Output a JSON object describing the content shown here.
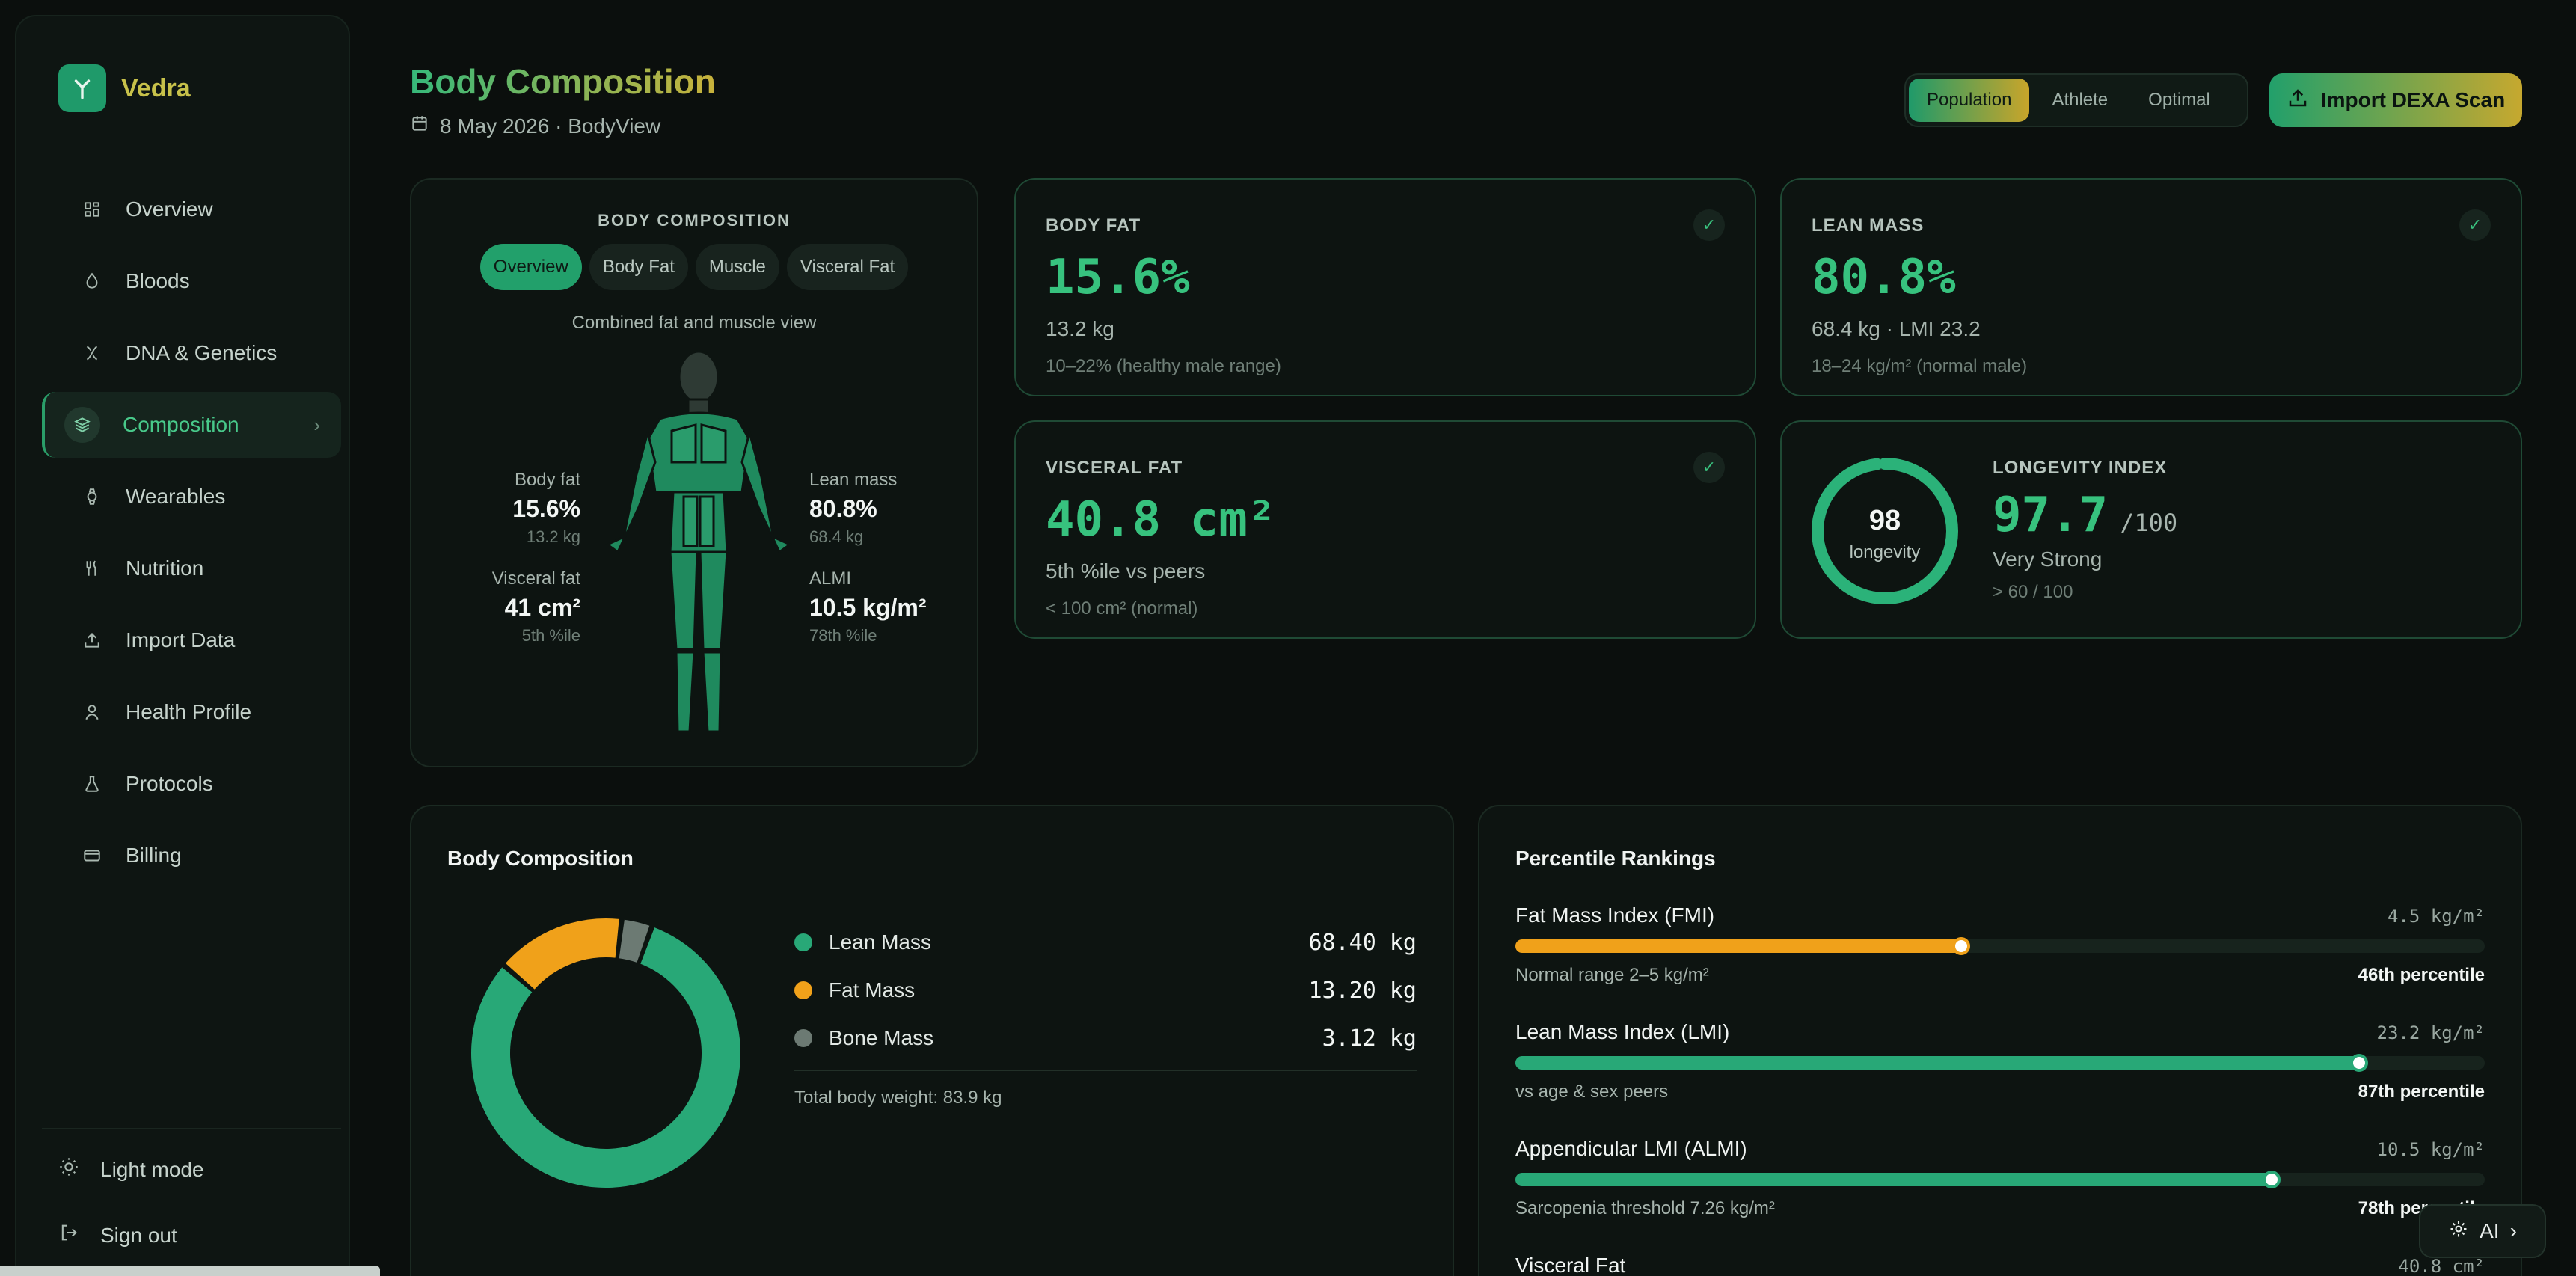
{
  "brand": {
    "name": "Vedra"
  },
  "sidebar": {
    "items": [
      {
        "label": "Overview",
        "icon": "grid-icon"
      },
      {
        "label": "Bloods",
        "icon": "drop-icon"
      },
      {
        "label": "DNA & Genetics",
        "icon": "dna-icon"
      },
      {
        "label": "Composition",
        "icon": "layers-icon",
        "active": true
      },
      {
        "label": "Wearables",
        "icon": "watch-icon"
      },
      {
        "label": "Nutrition",
        "icon": "utensils-icon"
      },
      {
        "label": "Import Data",
        "icon": "upload-icon"
      },
      {
        "label": "Health Profile",
        "icon": "user-icon"
      },
      {
        "label": "Protocols",
        "icon": "flask-icon"
      },
      {
        "label": "Billing",
        "icon": "card-icon"
      }
    ],
    "light_mode": "Light mode",
    "sign_out": "Sign out"
  },
  "header": {
    "title": "Body Composition",
    "subtitle": "8 May 2026 · BodyView",
    "segments": [
      "Population",
      "Athlete",
      "Optimal"
    ],
    "import_label": "Import DEXA Scan"
  },
  "body_map": {
    "title": "BODY COMPOSITION",
    "tabs": [
      "Overview",
      "Body Fat",
      "Muscle",
      "Visceral Fat"
    ],
    "caption": "Combined fat and muscle view",
    "stats": {
      "body_fat": {
        "label": "Body fat",
        "value": "15.6%",
        "sub": "13.2 kg"
      },
      "visceral": {
        "label": "Visceral fat",
        "value": "41 cm²",
        "sub": "5th %ile"
      },
      "lean": {
        "label": "Lean mass",
        "value": "80.8%",
        "sub": "68.4 kg"
      },
      "almi": {
        "label": "ALMI",
        "value": "10.5 kg/m²",
        "sub": "78th %ile"
      }
    }
  },
  "metrics": {
    "body_fat": {
      "label": "BODY FAT",
      "value": "15.6%",
      "sub": "13.2 kg",
      "note": "10–22% (healthy male range)"
    },
    "lean_mass": {
      "label": "LEAN MASS",
      "value": "80.8%",
      "sub": "68.4 kg · LMI 23.2",
      "note": "18–24 kg/m² (normal male)"
    },
    "visceral": {
      "label": "VISCERAL FAT",
      "value": "40.8 cm²",
      "sub": "5th %ile vs peers",
      "note": "< 100 cm² (normal)"
    },
    "longevity": {
      "label": "LONGEVITY INDEX",
      "ring_value": "98",
      "ring_label": "longevity",
      "score": 98,
      "value": "97.7",
      "unit": "/100",
      "sub": "Very Strong",
      "note": "> 60 / 100"
    }
  },
  "composition": {
    "title": "Body Composition",
    "rows": [
      {
        "label": "Lean Mass",
        "value": "68.40 kg",
        "color": "#28a877",
        "kg": 68.4
      },
      {
        "label": "Fat Mass",
        "value": "13.20 kg",
        "color": "#f0a11a",
        "kg": 13.2
      },
      {
        "label": "Bone Mass",
        "value": "3.12 kg",
        "color": "#6c7a73",
        "kg": 3.12
      }
    ],
    "total": "Total body weight: 83.9 kg"
  },
  "percentiles": {
    "title": "Percentile Rankings",
    "rows": [
      {
        "name": "Fat Mass Index (FMI)",
        "value": "4.5 kg/m²",
        "note": "Normal range 2–5 kg/m²",
        "percentile": "46th percentile",
        "fraction": 0.46,
        "color": "#f0a11a"
      },
      {
        "name": "Lean Mass Index (LMI)",
        "value": "23.2 kg/m²",
        "note": "vs age & sex peers",
        "percentile": "87th percentile",
        "fraction": 0.87,
        "color": "#28a877"
      },
      {
        "name": "Appendicular LMI (ALMI)",
        "value": "10.5 kg/m²",
        "note": "Sarcopenia threshold 7.26 kg/m²",
        "percentile": "78th percentile",
        "fraction": 0.78,
        "color": "#28a877"
      },
      {
        "name": "Visceral Fat",
        "value": "40.8 cm²"
      }
    ]
  },
  "ai": {
    "label": "AI"
  }
}
